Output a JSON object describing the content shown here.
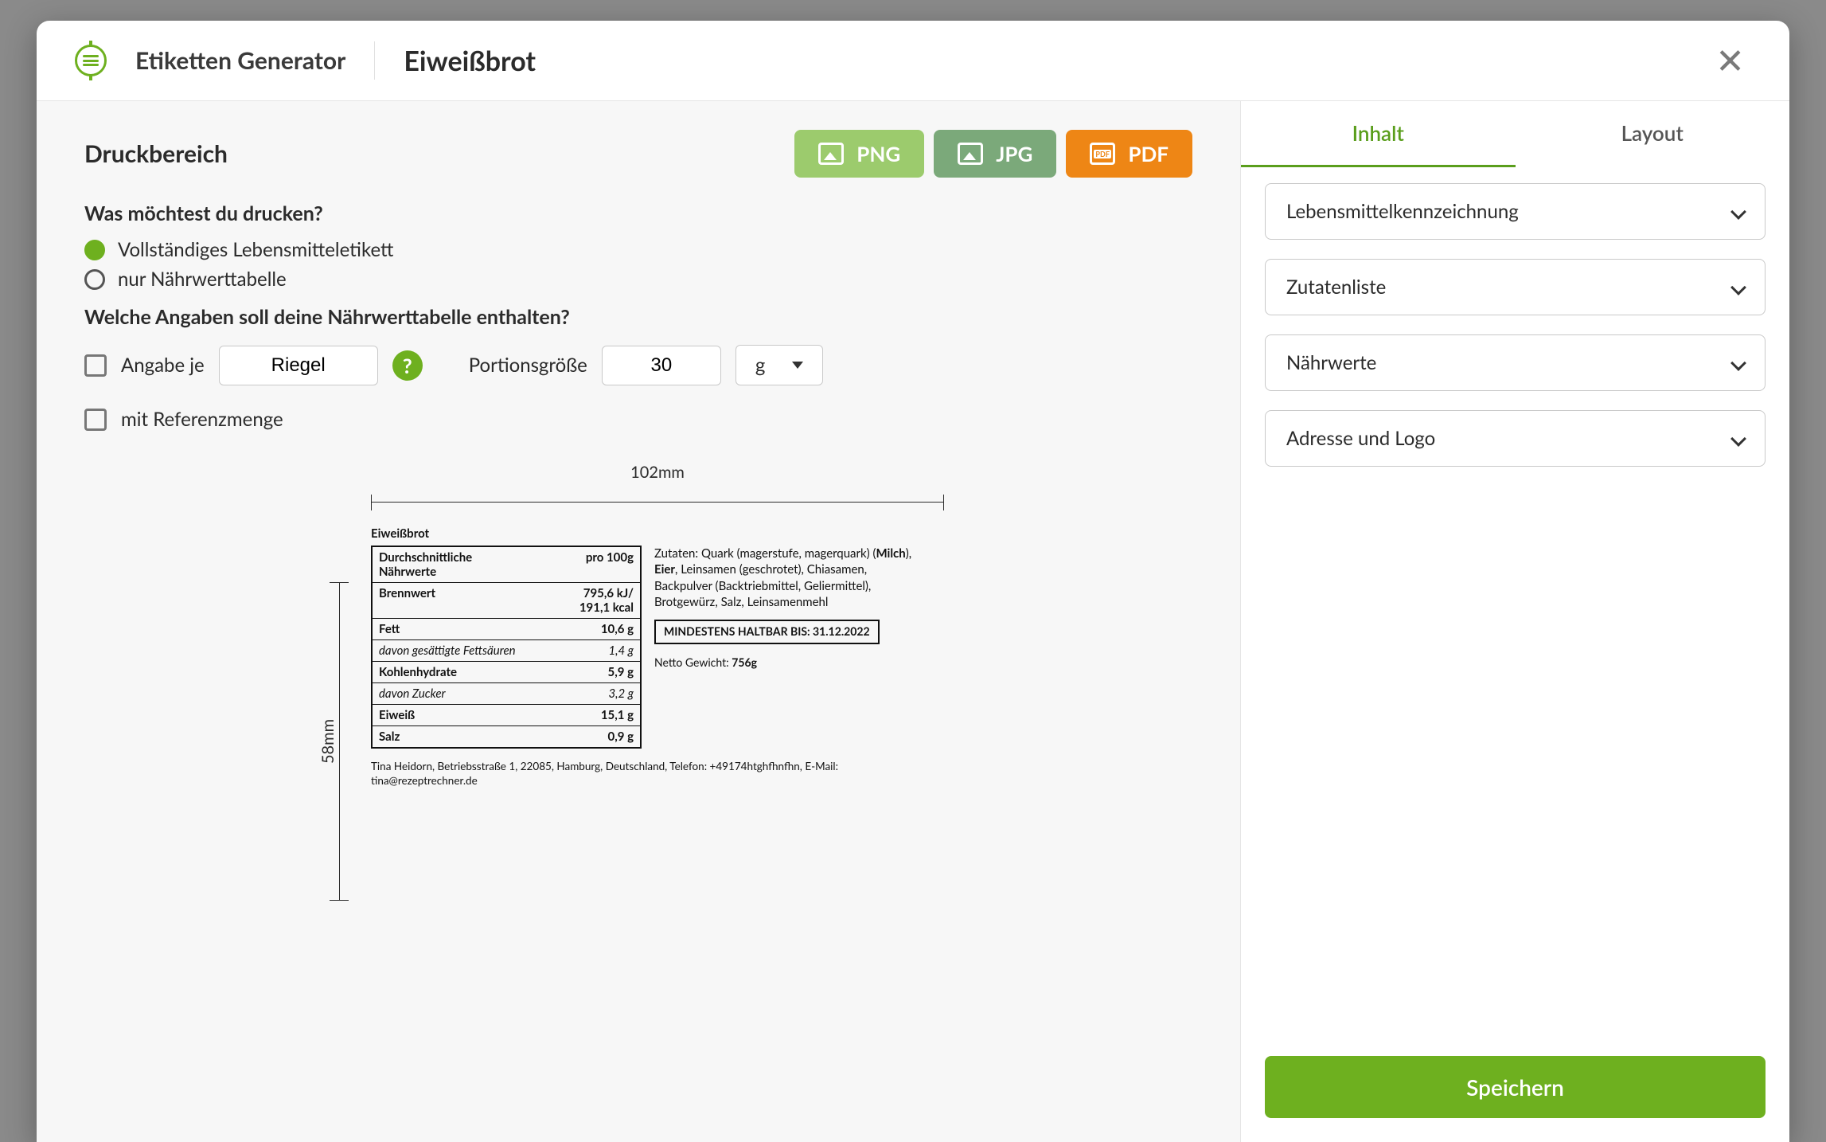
{
  "header": {
    "app_title": "Etiketten Generator",
    "recipe_title": "Eiweißbrot"
  },
  "left": {
    "section_title": "Druckbereich",
    "export": {
      "png": "PNG",
      "jpg": "JPG",
      "pdf": "PDF"
    },
    "q_what_print": "Was möchtest du drucken?",
    "radio_full": "Vollständiges Lebensmitteletikett",
    "radio_nutr_only": "nur Nährwerttabelle",
    "q_nutr_contain": "Welche Angaben soll deine Nährwerttabelle enthalten?",
    "angabe_je": "Angabe je",
    "angabe_je_value": "Riegel",
    "portion_label": "Portionsgröße",
    "portion_value": "30",
    "unit_value": "g",
    "ref_menge": "mit Referenzmenge",
    "dim_width": "102mm",
    "dim_height": "58mm"
  },
  "preview": {
    "title": "Eiweißbrot",
    "nutr_header_left": "Durchschnittliche Nährwerte",
    "nutr_header_right": "pro 100g",
    "rows": [
      {
        "k": "Brennwert",
        "v": "795,6 kJ/\n191,1 kcal",
        "sub": false
      },
      {
        "k": "Fett",
        "v": "10,6 g",
        "sub": false
      },
      {
        "k": "davon gesättigte Fettsäuren",
        "v": "1,4 g",
        "sub": true
      },
      {
        "k": "Kohlenhydrate",
        "v": "5,9 g",
        "sub": false
      },
      {
        "k": "davon Zucker",
        "v": "3,2 g",
        "sub": true
      },
      {
        "k": "Eiweiß",
        "v": "15,1 g",
        "sub": false
      },
      {
        "k": "Salz",
        "v": "0,9 g",
        "sub": false
      }
    ],
    "ingredients_prefix": "Zutaten: ",
    "ingredients_html": "Quark (magerstufe, magerquark) (<b>Milch</b>), <b>Eier</b>, Leinsamen (geschrotet), Chiasamen, Backpulver (Backtriebmittel, Geliermittel), Brotgewürz, Salz, Leinsamenmehl",
    "mhd_label": "MINDESTENS HALTBAR BIS:",
    "mhd_value": "31.12.2022",
    "net_label": "Netto Gewicht:",
    "net_value": "756g",
    "address": "Tina Heidorn, Betriebsstraße 1, 22085, Hamburg, Deutschland, Telefon: +49174htghfhnfhn, E-Mail: tina@rezeptrechner.de"
  },
  "right": {
    "tab_content": "Inhalt",
    "tab_layout": "Layout",
    "acc1": "Lebensmittelkennzeichnung",
    "acc2": "Zutatenliste",
    "acc3": "Nährwerte",
    "acc4": "Adresse und Logo",
    "save": "Speichern"
  }
}
